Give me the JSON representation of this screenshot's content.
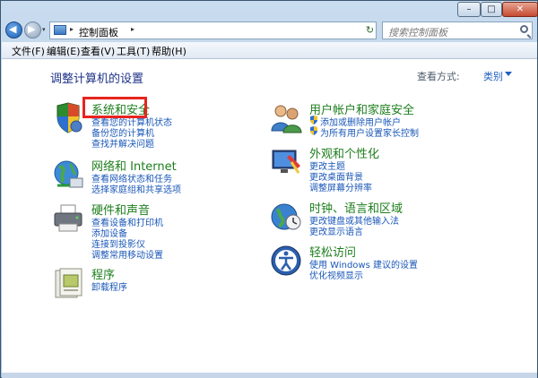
{
  "window": {
    "min_label": "–",
    "max_label": "□",
    "close_label": "✕"
  },
  "nav": {
    "back_symbol": "◀",
    "forward_symbol": "▶",
    "dropdown_symbol": "▾",
    "refresh_symbol": "↻"
  },
  "address": {
    "separator": "▸",
    "location": "控制面板",
    "dropdown_symbol": "▾"
  },
  "search": {
    "placeholder": "搜索控制面板"
  },
  "menu": {
    "file": "文件(F)",
    "edit": "编辑(E)",
    "view": "查看(V)",
    "tools": "工具(T)",
    "help": "帮助(H)"
  },
  "page": {
    "heading": "调整计算机的设置",
    "view_label": "查看方式:",
    "view_value": "类别"
  },
  "categories": {
    "system_security": {
      "title": "系统和安全",
      "links": [
        "查看您的计算机状态",
        "备份您的计算机",
        "查找并解决问题"
      ]
    },
    "network": {
      "title": "网络和 Internet",
      "links": [
        "查看网络状态和任务",
        "选择家庭组和共享选项"
      ]
    },
    "hardware": {
      "title": "硬件和声音",
      "links": [
        "查看设备和打印机",
        "添加设备",
        "连接到投影仪",
        "调整常用移动设置"
      ]
    },
    "programs": {
      "title": "程序",
      "links": [
        "卸载程序"
      ]
    },
    "accounts": {
      "title": "用户帐户和家庭安全",
      "links": [
        "添加或删除用户帐户",
        "为所有用户设置家长控制"
      ]
    },
    "appearance": {
      "title": "外观和个性化",
      "links": [
        "更改主题",
        "更改桌面背景",
        "调整屏幕分辨率"
      ]
    },
    "clock": {
      "title": "时钟、语言和区域",
      "links": [
        "更改键盘或其他输入法",
        "更改显示语言"
      ]
    },
    "ease": {
      "title": "轻松访问",
      "links": [
        "使用 Windows 建议的设置",
        "优化视频显示"
      ]
    }
  },
  "colors": {
    "heading": "#1e3287",
    "category_title": "#1e7e1e",
    "link": "#1a57b8",
    "highlight": "#e8241f"
  }
}
